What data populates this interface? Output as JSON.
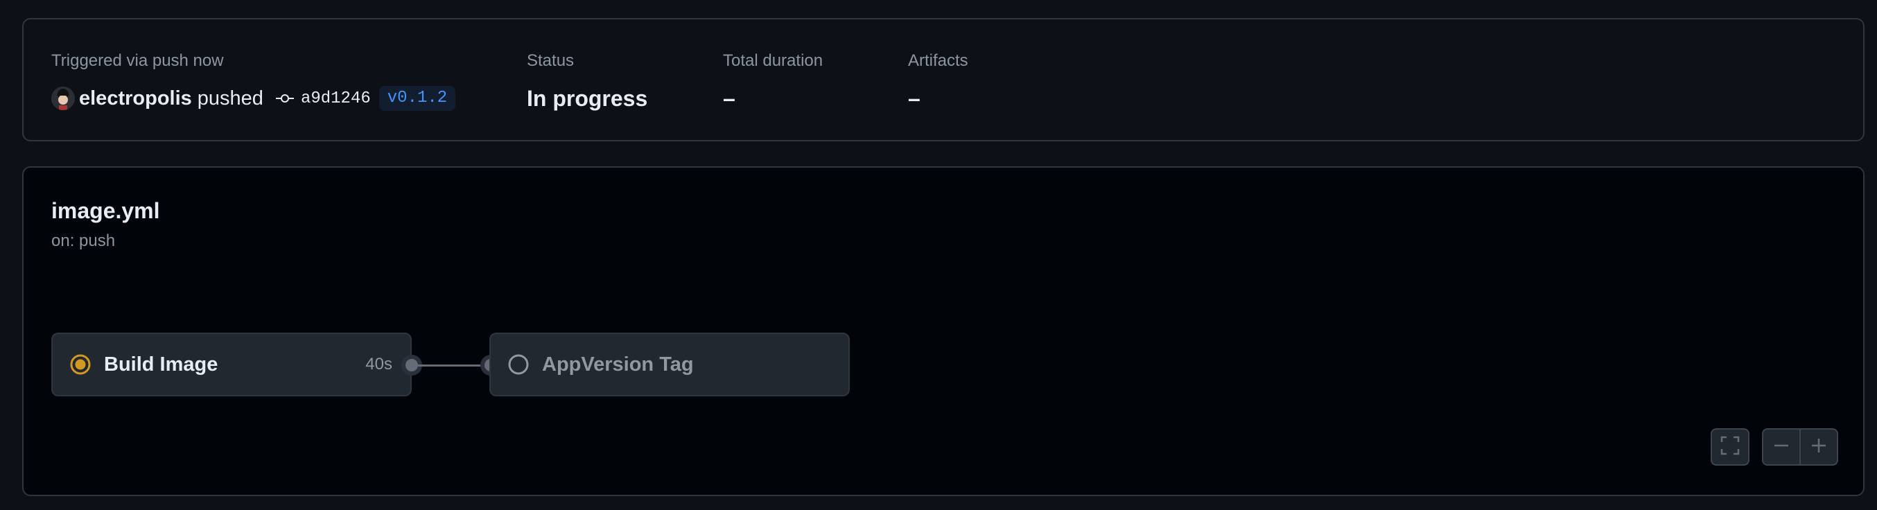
{
  "run_summary": {
    "trigger_label": "Triggered via push now",
    "actor": "electropolis",
    "action": "pushed",
    "commit_sha": "a9d1246",
    "tag": "v0.1.2",
    "status_label": "Status",
    "status_value": "In progress",
    "duration_label": "Total duration",
    "duration_value": "–",
    "artifacts_label": "Artifacts",
    "artifacts_value": "–"
  },
  "workflow": {
    "file_name": "image.yml",
    "trigger": "on: push",
    "jobs": [
      {
        "name": "Build Image",
        "duration": "40s",
        "status": "in-progress",
        "status_color": "#d29922"
      },
      {
        "name": "AppVersion Tag",
        "duration": "",
        "status": "queued",
        "status_color": "#9198a1"
      }
    ]
  },
  "controls": {
    "fullscreen_icon": "fullscreen-icon",
    "zoom_out_icon": "zoom-out-icon",
    "zoom_in_icon": "zoom-in-icon"
  },
  "colors": {
    "background": "#0d1117",
    "graph_background": "#010409",
    "border": "#30363d",
    "accent_blue": "#4493f8",
    "in_progress": "#d29922"
  }
}
